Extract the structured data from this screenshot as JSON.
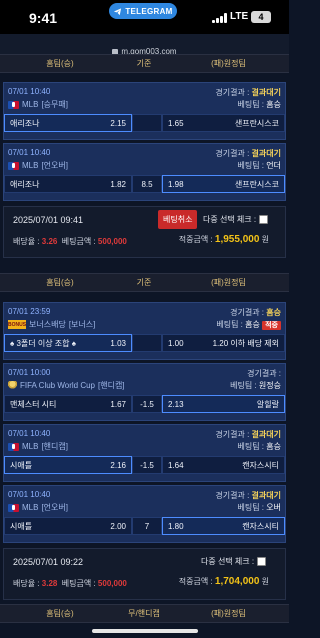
{
  "status": {
    "time": "9:41",
    "telegram": "TELEGRAM",
    "network": "LTE",
    "battery": "4"
  },
  "browser": {
    "url": "m.gom003.com"
  },
  "headers": {
    "h1": {
      "home": "홈팀(승)",
      "mid": "기준",
      "away": "(패)원정팀"
    },
    "h2": {
      "home": "홈팀(승)",
      "mid": "기준",
      "away": "(패)원정팀"
    },
    "h3": {
      "home": "홈팀(승)",
      "mid": "무/핸디캡",
      "away": "(패)원정팀"
    }
  },
  "group1": {
    "bets": [
      {
        "datetime": "07/01 10:40",
        "league": "MLB",
        "market": "[승무패]",
        "result_label": "경기결과 :",
        "result": "결과대기",
        "pick_label": "베팅팀 :",
        "pick": "홈승",
        "home": "애리조나",
        "home_odds": "2.15",
        "mid": "",
        "away_odds": "1.65",
        "away": "샌프란시스코"
      },
      {
        "datetime": "07/01 10:40",
        "league": "MLB",
        "market": "[언오버]",
        "result_label": "경기결과 :",
        "result": "결과대기",
        "pick_label": "베팅팀 :",
        "pick": "언더",
        "home": "애리조나",
        "home_odds": "1.82",
        "mid": "8.5",
        "away_odds": "1.98",
        "away": "샌프란시스코"
      }
    ],
    "summary": {
      "datetime": "2025/07/01 09:41",
      "cancel": "베팅취소",
      "multi": "다중 선택 체크 :",
      "rate_label": "배당율 :",
      "rate": "3.26",
      "amount_label": "베팅금액 :",
      "amount": "500,000",
      "win_label": "적중금액 :",
      "win": "1,955,000",
      "unit": "원"
    }
  },
  "group2": {
    "bets": [
      {
        "datetime": "07/01 23:59",
        "league": "보너스배당",
        "market": "[보너스]",
        "result_label": "경기결과 :",
        "result": "홈승",
        "pick_label": "베팅팀 :",
        "pick": "홈승",
        "status": "적중",
        "home": "♠ 3폴더 이상 조합 ♠",
        "home_odds": "1.03",
        "mid": "",
        "away_odds": "1.00",
        "away": "1.20 이하 배당 제외"
      },
      {
        "datetime": "07/01 10:00",
        "league": "FIFA Club World Cup",
        "market": "[핸디캡]",
        "result_label": "경기결과 :",
        "result": "",
        "pick_label": "베팅팀 :",
        "pick": "원정승",
        "home": "맨체스터 시티",
        "home_odds": "1.67",
        "mid": "-1.5",
        "away_odds": "2.13",
        "away": "알힐랄"
      },
      {
        "datetime": "07/01 10:40",
        "league": "MLB",
        "market": "[핸디캡]",
        "result_label": "경기결과 :",
        "result": "결과대기",
        "pick_label": "베팅팀 :",
        "pick": "홈승",
        "home": "시애틀",
        "home_odds": "2.16",
        "mid": "-1.5",
        "away_odds": "1.64",
        "away": "캔자스시티"
      },
      {
        "datetime": "07/01 10:40",
        "league": "MLB",
        "market": "[언오버]",
        "result_label": "경기결과 :",
        "result": "결과대기",
        "pick_label": "베팅팀 :",
        "pick": "오버",
        "home": "시애틀",
        "home_odds": "2.00",
        "mid": "7",
        "away_odds": "1.80",
        "away": "캔자스시티"
      }
    ],
    "summary": {
      "datetime": "2025/07/01 09:22",
      "multi": "다중 선택 체크 :",
      "rate_label": "배당율 :",
      "rate": "3.28",
      "amount_label": "베팅금액 :",
      "amount": "500,000",
      "win_label": "적중금액 :",
      "win": "1,704,000",
      "unit": "원"
    }
  },
  "colors": {
    "accent_yellow": "#f3d15a",
    "card_blue": "#1b2f5c",
    "danger_red": "#c92a2a"
  }
}
